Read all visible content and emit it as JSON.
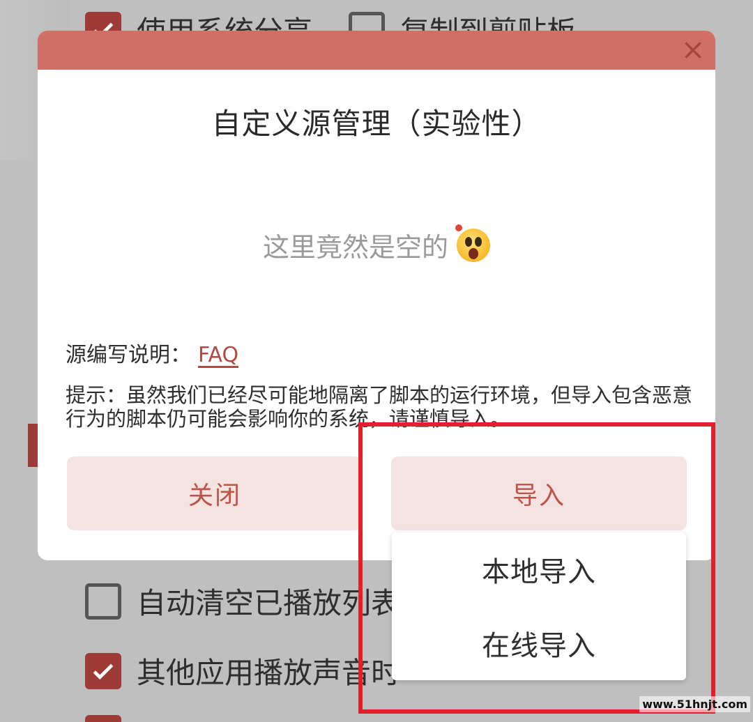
{
  "background": {
    "top_row": [
      {
        "label": "使用系统分享",
        "checked": true
      },
      {
        "label": "复制到剪贴板",
        "checked": false
      }
    ],
    "lower_rows": [
      {
        "label": "自动清空已播放列表",
        "checked": false
      },
      {
        "label": "其他应用播放声音时",
        "checked": true
      }
    ]
  },
  "dialog": {
    "title": "自定义源管理（实验性）",
    "empty_message": "这里竟然是空的",
    "empty_emoji": "astonished-face",
    "faq_prefix": "源编写说明：",
    "faq_link": "FAQ",
    "hint": "提示：虽然我们已经尽可能地隔离了脚本的运行环境，但导入包含恶意行为的脚本仍可能会影响你的系统，请谨慎导入。",
    "close_button": "关闭",
    "import_button": "导入"
  },
  "import_menu": {
    "items": [
      "本地导入",
      "在线导入"
    ]
  },
  "watermark": "www.51hnjt.com",
  "colors": {
    "accent": "#9e3b36",
    "header": "#d06f66",
    "button_bg": "#f5e3e1",
    "button_text": "#bf5249",
    "annotation": "#e1202a"
  }
}
